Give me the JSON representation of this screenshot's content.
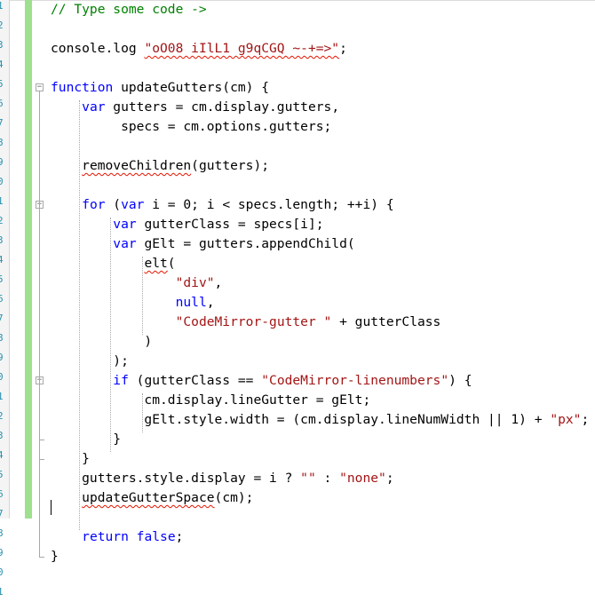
{
  "editor": {
    "line_numbers": [
      "1",
      "2",
      "3",
      "4",
      "5",
      "6",
      "7",
      "8",
      "9",
      "0",
      "1",
      "2",
      "3",
      "4",
      "5",
      "6",
      "7",
      "8",
      "9",
      "0",
      "1",
      "2",
      "3",
      "4",
      "5",
      "6",
      "7",
      "8",
      "9",
      "0",
      "1"
    ],
    "lines": [
      {
        "parts": [
          {
            "t": "// Type some code ->",
            "c": "cm"
          }
        ]
      },
      {
        "parts": []
      },
      {
        "parts": [
          {
            "t": "console.log ",
            "c": ""
          },
          {
            "t": "\"oO08 iIlL1 g9qCGQ ~-+=>\"",
            "c": "str sq"
          },
          {
            "t": ";",
            "c": ""
          }
        ]
      },
      {
        "parts": []
      },
      {
        "parts": [
          {
            "t": "function",
            "c": "kw"
          },
          {
            "t": " updateGutters(cm) {",
            "c": ""
          }
        ]
      },
      {
        "parts": [
          {
            "t": "    ",
            "c": ""
          },
          {
            "t": "var",
            "c": "kw"
          },
          {
            "t": " gutters = cm.display.gutters,",
            "c": ""
          }
        ]
      },
      {
        "parts": [
          {
            "t": "         specs = cm.options.gutters;",
            "c": ""
          }
        ]
      },
      {
        "parts": []
      },
      {
        "parts": [
          {
            "t": "    ",
            "c": ""
          },
          {
            "t": "removeChildren",
            "c": "sq"
          },
          {
            "t": "(gutters);",
            "c": ""
          }
        ]
      },
      {
        "parts": []
      },
      {
        "parts": [
          {
            "t": "    ",
            "c": ""
          },
          {
            "t": "for",
            "c": "kw"
          },
          {
            "t": " (",
            "c": ""
          },
          {
            "t": "var",
            "c": "kw"
          },
          {
            "t": " i = 0; i < specs.length; ++i) {",
            "c": ""
          }
        ]
      },
      {
        "parts": [
          {
            "t": "        ",
            "c": ""
          },
          {
            "t": "var",
            "c": "kw"
          },
          {
            "t": " gutterClass = specs[i];",
            "c": ""
          }
        ]
      },
      {
        "parts": [
          {
            "t": "        ",
            "c": ""
          },
          {
            "t": "var",
            "c": "kw"
          },
          {
            "t": " gElt = gutters.appendChild(",
            "c": ""
          }
        ]
      },
      {
        "parts": [
          {
            "t": "            ",
            "c": ""
          },
          {
            "t": "elt",
            "c": "sq"
          },
          {
            "t": "(",
            "c": ""
          }
        ]
      },
      {
        "parts": [
          {
            "t": "                ",
            "c": ""
          },
          {
            "t": "\"div\"",
            "c": "str"
          },
          {
            "t": ",",
            "c": ""
          }
        ]
      },
      {
        "parts": [
          {
            "t": "                ",
            "c": ""
          },
          {
            "t": "null",
            "c": "kw"
          },
          {
            "t": ",",
            "c": ""
          }
        ]
      },
      {
        "parts": [
          {
            "t": "                ",
            "c": ""
          },
          {
            "t": "\"CodeMirror-gutter \"",
            "c": "str"
          },
          {
            "t": " + gutterClass",
            "c": ""
          }
        ]
      },
      {
        "parts": [
          {
            "t": "            )",
            "c": ""
          }
        ]
      },
      {
        "parts": [
          {
            "t": "        );",
            "c": ""
          }
        ]
      },
      {
        "parts": [
          {
            "t": "        ",
            "c": ""
          },
          {
            "t": "if",
            "c": "kw"
          },
          {
            "t": " (gutterClass == ",
            "c": ""
          },
          {
            "t": "\"CodeMirror-linenumbers\"",
            "c": "str"
          },
          {
            "t": ") {",
            "c": ""
          }
        ]
      },
      {
        "parts": [
          {
            "t": "            cm.display.lineGutter = gElt;",
            "c": ""
          }
        ]
      },
      {
        "parts": [
          {
            "t": "            gElt.style.width = (cm.display.lineNumWidth || 1) + ",
            "c": ""
          },
          {
            "t": "\"px\"",
            "c": "str"
          },
          {
            "t": ";",
            "c": ""
          }
        ]
      },
      {
        "parts": [
          {
            "t": "        }",
            "c": ""
          }
        ]
      },
      {
        "parts": [
          {
            "t": "    }",
            "c": ""
          }
        ]
      },
      {
        "parts": [
          {
            "t": "    gutters.style.display = i ? ",
            "c": ""
          },
          {
            "t": "\"\"",
            "c": "str"
          },
          {
            "t": " : ",
            "c": ""
          },
          {
            "t": "\"none\"",
            "c": "str"
          },
          {
            "t": ";",
            "c": ""
          }
        ]
      },
      {
        "parts": [
          {
            "t": "    ",
            "c": ""
          },
          {
            "t": "updateGutterSpace",
            "c": "sq"
          },
          {
            "t": "(cm);",
            "c": ""
          }
        ]
      },
      {
        "parts": []
      },
      {
        "parts": [
          {
            "t": "    ",
            "c": ""
          },
          {
            "t": "return",
            "c": "kw"
          },
          {
            "t": " ",
            "c": ""
          },
          {
            "t": "false",
            "c": "kw"
          },
          {
            "t": ";",
            "c": ""
          }
        ]
      },
      {
        "parts": [
          {
            "t": "}",
            "c": ""
          }
        ]
      },
      {
        "parts": []
      },
      {
        "parts": []
      }
    ],
    "fold_markers": [
      {
        "line": 5,
        "symbol": "−"
      },
      {
        "line": 11,
        "symbol": "−"
      },
      {
        "line": 20,
        "symbol": "−"
      }
    ],
    "colors": {
      "keyword": "#0000ff",
      "string": "#a31515",
      "comment": "#008000",
      "squiggle": "#e51400",
      "changed_margin": "#9fe08e"
    }
  }
}
